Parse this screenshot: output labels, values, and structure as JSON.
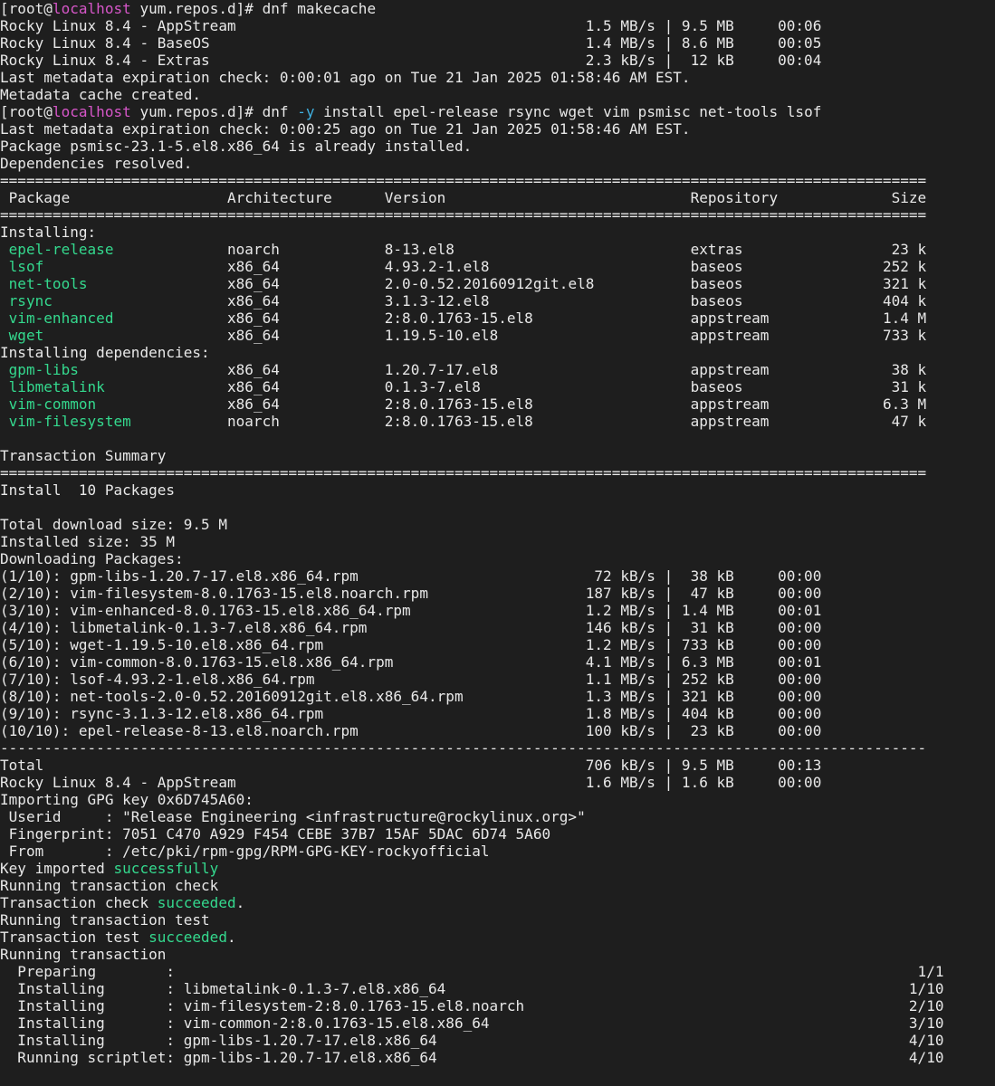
{
  "colors": {
    "background": "#1e1e1e",
    "text": "#e8e8e8",
    "hostname": "#d656c8",
    "option": "#3fb0e0",
    "package_name": "#34d98e",
    "success": "#34d98e"
  },
  "lines": [
    [
      {
        "t": "[root@",
        "c": "normal"
      },
      {
        "t": "localhost",
        "c": "host"
      },
      {
        "t": " yum.repos.d]# dnf makecache",
        "c": "normal"
      }
    ],
    [
      {
        "t": "Rocky Linux 8.4 - AppStream                                        1.5 MB/s | 9.5 MB     00:06",
        "c": "normal"
      }
    ],
    [
      {
        "t": "Rocky Linux 8.4 - BaseOS                                           1.4 MB/s | 8.6 MB     00:05",
        "c": "normal"
      }
    ],
    [
      {
        "t": "Rocky Linux 8.4 - Extras                                           2.3 kB/s |  12 kB     00:04",
        "c": "normal"
      }
    ],
    [
      {
        "t": "Last metadata expiration check: 0:00:01 ago on Tue 21 Jan 2025 01:58:46 AM EST.",
        "c": "normal"
      }
    ],
    [
      {
        "t": "Metadata cache created.",
        "c": "normal"
      }
    ],
    [
      {
        "t": "[root@",
        "c": "normal"
      },
      {
        "t": "localhost",
        "c": "host"
      },
      {
        "t": " yum.repos.d]# dnf ",
        "c": "normal"
      },
      {
        "t": "-y",
        "c": "opt"
      },
      {
        "t": " install epel-release rsync wget vim psmisc net-tools lsof",
        "c": "normal"
      }
    ],
    [
      {
        "t": "Last metadata expiration check: 0:00:25 ago on Tue 21 Jan 2025 01:58:46 AM EST.",
        "c": "normal"
      }
    ],
    [
      {
        "t": "Package psmisc-23.1-5.el8.x86_64 is already installed.",
        "c": "normal"
      }
    ],
    [
      {
        "t": "Dependencies resolved.",
        "c": "normal"
      }
    ],
    [
      {
        "t": "==========================================================================================================",
        "c": "normal"
      }
    ],
    [
      {
        "t": " Package                  Architecture      Version                            Repository             Size",
        "c": "normal"
      }
    ],
    [
      {
        "t": "==========================================================================================================",
        "c": "normal"
      }
    ],
    [
      {
        "t": "Installing:",
        "c": "normal"
      }
    ],
    [
      {
        "t": " ",
        "c": "normal"
      },
      {
        "t": "epel-release",
        "c": "pkg"
      },
      {
        "t": "             noarch            8-13.el8                           extras                 23 k",
        "c": "normal"
      }
    ],
    [
      {
        "t": " ",
        "c": "normal"
      },
      {
        "t": "lsof",
        "c": "pkg"
      },
      {
        "t": "                     x86_64            4.93.2-1.el8                       baseos                252 k",
        "c": "normal"
      }
    ],
    [
      {
        "t": " ",
        "c": "normal"
      },
      {
        "t": "net-tools",
        "c": "pkg"
      },
      {
        "t": "                x86_64            2.0-0.52.20160912git.el8           baseos                321 k",
        "c": "normal"
      }
    ],
    [
      {
        "t": " ",
        "c": "normal"
      },
      {
        "t": "rsync",
        "c": "pkg"
      },
      {
        "t": "                    x86_64            3.1.3-12.el8                       baseos                404 k",
        "c": "normal"
      }
    ],
    [
      {
        "t": " ",
        "c": "normal"
      },
      {
        "t": "vim-enhanced",
        "c": "pkg"
      },
      {
        "t": "             x86_64            2:8.0.1763-15.el8                  appstream             1.4 M",
        "c": "normal"
      }
    ],
    [
      {
        "t": " ",
        "c": "normal"
      },
      {
        "t": "wget",
        "c": "pkg"
      },
      {
        "t": "                     x86_64            1.19.5-10.el8                      appstream             733 k",
        "c": "normal"
      }
    ],
    [
      {
        "t": "Installing dependencies:",
        "c": "normal"
      }
    ],
    [
      {
        "t": " ",
        "c": "normal"
      },
      {
        "t": "gpm-libs",
        "c": "pkg"
      },
      {
        "t": "                 x86_64            1.20.7-17.el8                      appstream              38 k",
        "c": "normal"
      }
    ],
    [
      {
        "t": " ",
        "c": "normal"
      },
      {
        "t": "libmetalink",
        "c": "pkg"
      },
      {
        "t": "              x86_64            0.1.3-7.el8                        baseos                 31 k",
        "c": "normal"
      }
    ],
    [
      {
        "t": " ",
        "c": "normal"
      },
      {
        "t": "vim-common",
        "c": "pkg"
      },
      {
        "t": "               x86_64            2:8.0.1763-15.el8                  appstream             6.3 M",
        "c": "normal"
      }
    ],
    [
      {
        "t": " ",
        "c": "normal"
      },
      {
        "t": "vim-filesystem",
        "c": "pkg"
      },
      {
        "t": "           noarch            2:8.0.1763-15.el8                  appstream              47 k",
        "c": "normal"
      }
    ],
    [
      {
        "t": "",
        "c": "normal"
      }
    ],
    [
      {
        "t": "Transaction Summary",
        "c": "normal"
      }
    ],
    [
      {
        "t": "==========================================================================================================",
        "c": "normal"
      }
    ],
    [
      {
        "t": "Install  10 Packages",
        "c": "normal"
      }
    ],
    [
      {
        "t": "",
        "c": "normal"
      }
    ],
    [
      {
        "t": "Total download size: 9.5 M",
        "c": "normal"
      }
    ],
    [
      {
        "t": "Installed size: 35 M",
        "c": "normal"
      }
    ],
    [
      {
        "t": "Downloading Packages:",
        "c": "normal"
      }
    ],
    [
      {
        "t": "(1/10): gpm-libs-1.20.7-17.el8.x86_64.rpm                           72 kB/s |  38 kB     00:00",
        "c": "normal"
      }
    ],
    [
      {
        "t": "(2/10): vim-filesystem-8.0.1763-15.el8.noarch.rpm                  187 kB/s |  47 kB     00:00",
        "c": "normal"
      }
    ],
    [
      {
        "t": "(3/10): vim-enhanced-8.0.1763-15.el8.x86_64.rpm                    1.2 MB/s | 1.4 MB     00:01",
        "c": "normal"
      }
    ],
    [
      {
        "t": "(4/10): libmetalink-0.1.3-7.el8.x86_64.rpm                         146 kB/s |  31 kB     00:00",
        "c": "normal"
      }
    ],
    [
      {
        "t": "(5/10): wget-1.19.5-10.el8.x86_64.rpm                              1.2 MB/s | 733 kB     00:00",
        "c": "normal"
      }
    ],
    [
      {
        "t": "(6/10): vim-common-8.0.1763-15.el8.x86_64.rpm                      4.1 MB/s | 6.3 MB     00:01",
        "c": "normal"
      }
    ],
    [
      {
        "t": "(7/10): lsof-4.93.2-1.el8.x86_64.rpm                               1.1 MB/s | 252 kB     00:00",
        "c": "normal"
      }
    ],
    [
      {
        "t": "(8/10): net-tools-2.0-0.52.20160912git.el8.x86_64.rpm              1.3 MB/s | 321 kB     00:00",
        "c": "normal"
      }
    ],
    [
      {
        "t": "(9/10): rsync-3.1.3-12.el8.x86_64.rpm                              1.8 MB/s | 404 kB     00:00",
        "c": "normal"
      }
    ],
    [
      {
        "t": "(10/10): epel-release-8-13.el8.noarch.rpm                          100 kB/s |  23 kB     00:00",
        "c": "normal"
      }
    ],
    [
      {
        "t": "----------------------------------------------------------------------------------------------------------",
        "c": "normal"
      }
    ],
    [
      {
        "t": "Total                                                              706 kB/s | 9.5 MB     00:13",
        "c": "normal"
      }
    ],
    [
      {
        "t": "Rocky Linux 8.4 - AppStream                                        1.6 MB/s | 1.6 kB     00:00",
        "c": "normal"
      }
    ],
    [
      {
        "t": "Importing GPG key 0x6D745A60:",
        "c": "normal"
      }
    ],
    [
      {
        "t": " Userid     : \"Release Engineering <infrastructure@rockylinux.org>\"",
        "c": "normal"
      }
    ],
    [
      {
        "t": " Fingerprint: 7051 C470 A929 F454 CEBE 37B7 15AF 5DAC 6D74 5A60",
        "c": "normal"
      }
    ],
    [
      {
        "t": " From       : /etc/pki/rpm-gpg/RPM-GPG-KEY-rockyofficial",
        "c": "normal"
      }
    ],
    [
      {
        "t": "Key imported ",
        "c": "normal"
      },
      {
        "t": "successfully",
        "c": "ok"
      }
    ],
    [
      {
        "t": "Running transaction check",
        "c": "normal"
      }
    ],
    [
      {
        "t": "Transaction check ",
        "c": "normal"
      },
      {
        "t": "succeeded",
        "c": "ok"
      },
      {
        "t": ".",
        "c": "normal"
      }
    ],
    [
      {
        "t": "Running transaction test",
        "c": "normal"
      }
    ],
    [
      {
        "t": "Transaction test ",
        "c": "normal"
      },
      {
        "t": "succeeded",
        "c": "ok"
      },
      {
        "t": ".",
        "c": "normal"
      }
    ],
    [
      {
        "t": "Running transaction",
        "c": "normal"
      }
    ],
    [
      {
        "t": "  Preparing        :                                                                                     1/1",
        "c": "normal"
      }
    ],
    [
      {
        "t": "  Installing       : libmetalink-0.1.3-7.el8.x86_64                                                     1/10",
        "c": "normal"
      }
    ],
    [
      {
        "t": "  Installing       : vim-filesystem-2:8.0.1763-15.el8.noarch                                            2/10",
        "c": "normal"
      }
    ],
    [
      {
        "t": "  Installing       : vim-common-2:8.0.1763-15.el8.x86_64                                                3/10",
        "c": "normal"
      }
    ],
    [
      {
        "t": "  Installing       : gpm-libs-1.20.7-17.el8.x86_64                                                      4/10",
        "c": "normal"
      }
    ],
    [
      {
        "t": "  Running scriptlet: gpm-libs-1.20.7-17.el8.x86_64                                                      4/10",
        "c": "normal"
      }
    ]
  ]
}
